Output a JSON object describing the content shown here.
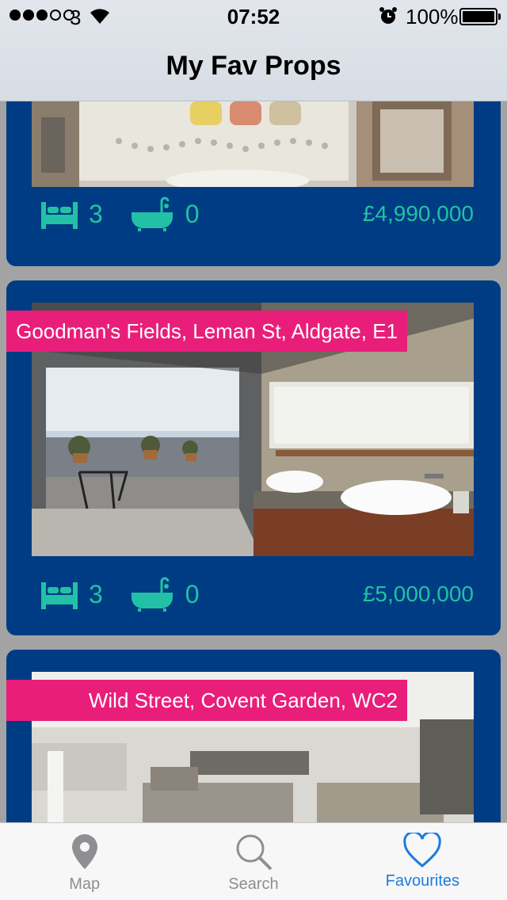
{
  "status_bar": {
    "carrier": "3",
    "time": "07:52",
    "battery": "100%"
  },
  "nav": {
    "title": "My Fav Props"
  },
  "listings": [
    {
      "address": "",
      "beds": "3",
      "baths": "0",
      "price": "£4,990,000"
    },
    {
      "address": "Goodman's Fields, Leman St, Aldgate, E1",
      "beds": "3",
      "baths": "0",
      "price": "£5,000,000"
    },
    {
      "address": "Wild Street, Covent Garden, WC2",
      "beds": "",
      "baths": "",
      "price": ""
    }
  ],
  "tabs": [
    {
      "label": "Map",
      "icon": "map-pin-icon",
      "active": false
    },
    {
      "label": "Search",
      "icon": "search-icon",
      "active": false
    },
    {
      "label": "Favourites",
      "icon": "heart-icon",
      "active": true
    }
  ],
  "colors": {
    "card_bg": "#003c83",
    "accent_teal": "#22c1a5",
    "address_pink": "#e91e7a",
    "tab_active": "#1a7ddc"
  }
}
